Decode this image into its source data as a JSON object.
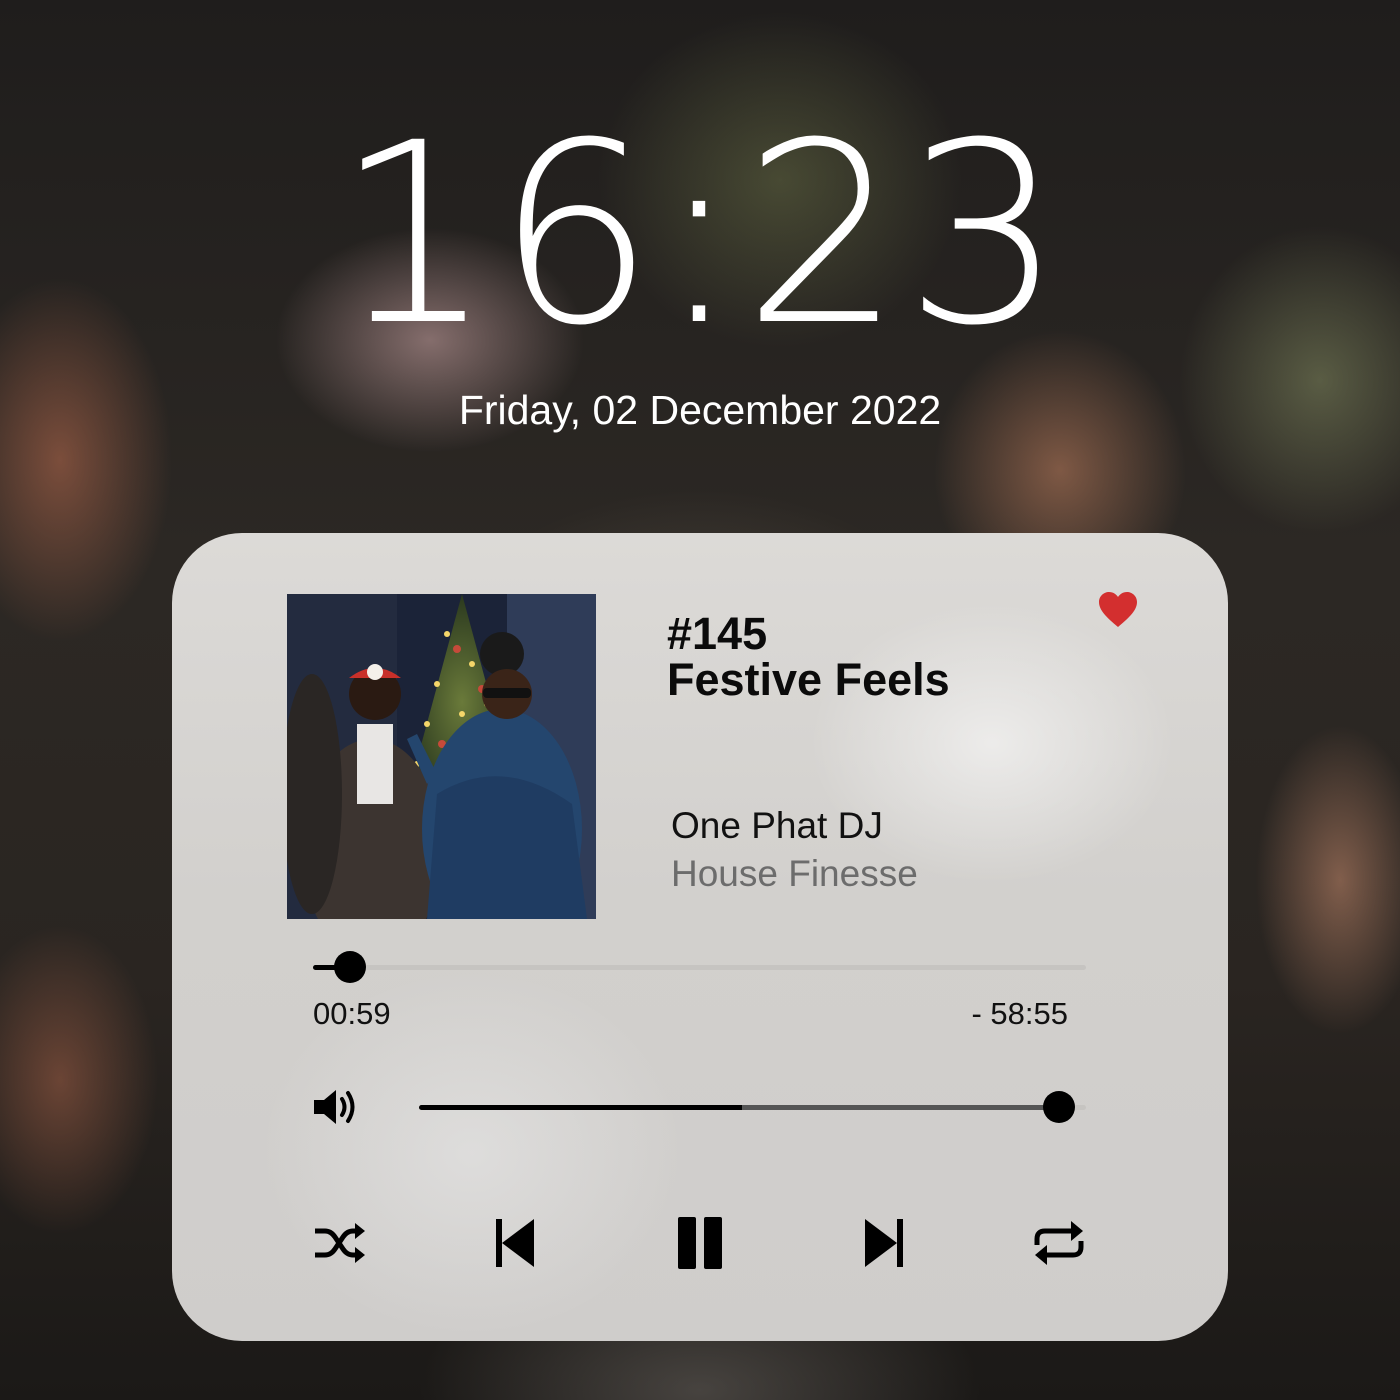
{
  "lock_screen": {
    "time": "16:23",
    "date": "Friday, 02 December 2022"
  },
  "player": {
    "episode": "#145",
    "title": "Festive Feels",
    "artist": "One Phat DJ",
    "genre": "House Finesse",
    "favorite": true,
    "heart_color": "#d32f2f",
    "album_art_icon": "festive-party-photo",
    "progress": {
      "elapsed": "00:59",
      "remaining": "- 58:55",
      "fraction": 0.048
    },
    "volume": {
      "level": 0.96,
      "dark_fraction": 0.485
    },
    "controls": [
      "shuffle-icon",
      "previous-icon",
      "pause-icon",
      "next-icon",
      "repeat-icon"
    ]
  }
}
